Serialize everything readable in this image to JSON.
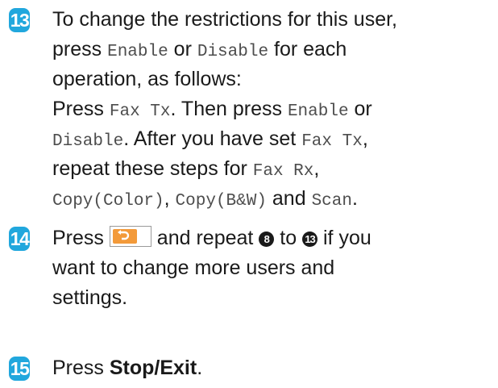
{
  "steps": [
    {
      "number": "13",
      "line1": "To change the restrictions for this user,",
      "line2": {
        "t1": "press ",
        "m1": "Enable",
        "t2": " or ",
        "m2": "Disable",
        "t3": " for each"
      },
      "line3": "operation, as follows:",
      "line4": {
        "t1": "Press ",
        "m1": "Fax Tx",
        "t2": ". Then press ",
        "m2": "Enable",
        "t3": " or"
      },
      "line5": {
        "m1": "Disable",
        "t1": ". After you have set ",
        "m2": "Fax Tx",
        "t2": ","
      },
      "line6": {
        "t1": "repeat these steps for ",
        "m1": "Fax Rx",
        "t2": ","
      },
      "line7": {
        "m1": "Copy(Color)",
        "t1": ", ",
        "m2": "Copy(B&W)",
        "t2": " and ",
        "m3": "Scan",
        "t3": "."
      }
    },
    {
      "number": "14",
      "line1": {
        "t1": "Press ",
        "t2": " and repeat ",
        "ref1": "8",
        "t3": " to ",
        "ref2": "13",
        "t4": " if you"
      },
      "line2": "want to change more users and",
      "line3": "settings.",
      "button_icon": "back-arrow-icon"
    },
    {
      "number": "15",
      "line1": {
        "t1": "Press ",
        "bold": "Stop/Exit",
        "t2": "."
      }
    }
  ]
}
